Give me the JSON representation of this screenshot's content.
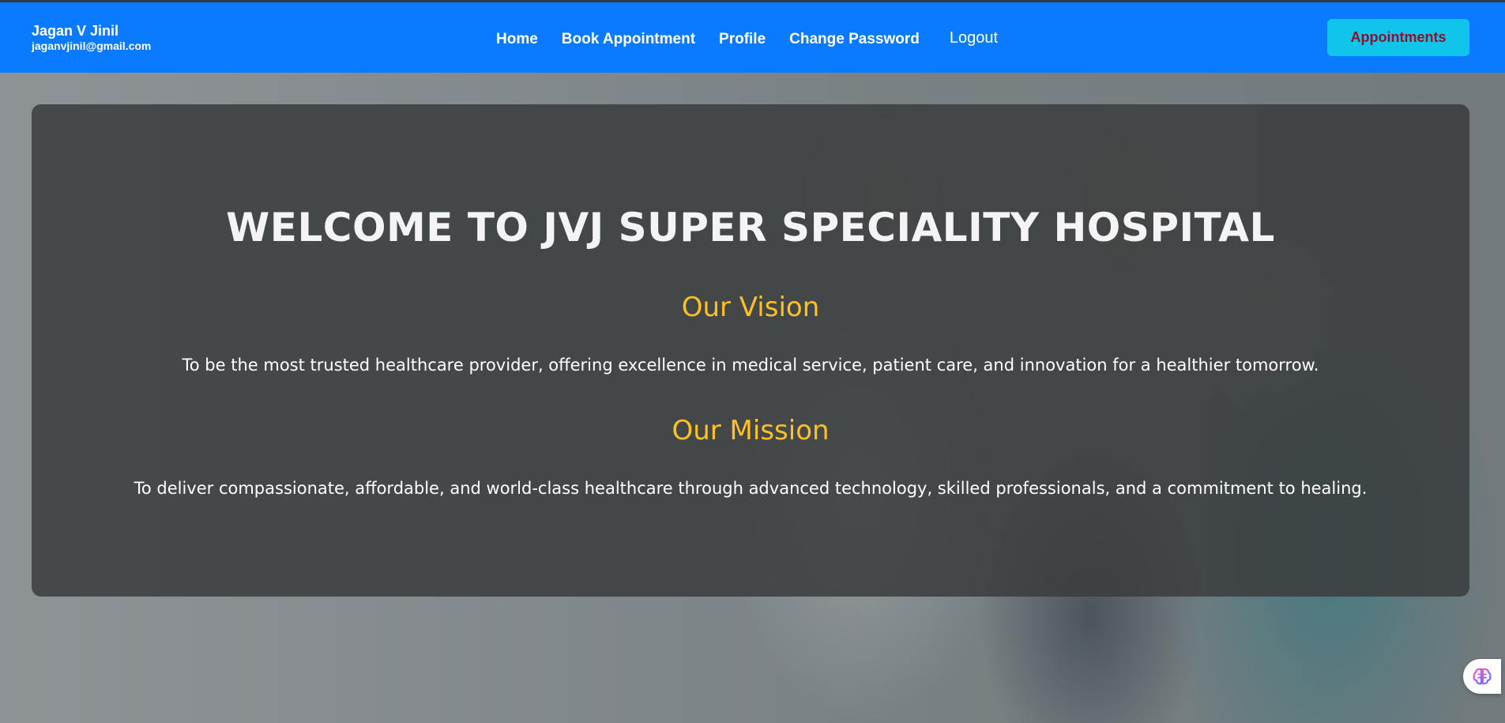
{
  "user": {
    "name": "Jagan V Jinil",
    "email": "jaganvjinil@gmail.com"
  },
  "nav": {
    "links": [
      {
        "label": "Home"
      },
      {
        "label": "Book Appointment"
      },
      {
        "label": "Profile"
      },
      {
        "label": "Change Password"
      },
      {
        "label": "Logout"
      }
    ],
    "appointments_button": "Appointments"
  },
  "hero": {
    "title": "WELCOME TO JVJ SUPER SPECIALITY HOSPITAL",
    "vision": {
      "heading": "Our Vision",
      "text": "To be the most trusted healthcare provider, offering excellence in medical service, patient care, and innovation for a healthier tomorrow."
    },
    "mission": {
      "heading": "Our Mission",
      "text": "To deliver compassionate, affordable, and world-class healthcare through advanced technology, skilled professionals, and a commitment to healing."
    }
  },
  "background": {
    "image_description_icon": "doctors-photo"
  },
  "assistant": {
    "icon": "brain-icon"
  },
  "colors": {
    "navbar": "#0a7bff",
    "appointments_button_bg": "#11c5ea",
    "appointments_button_text": "#8b1230",
    "section_heading": "#ffc021",
    "card_bg": "#3a3c3e"
  }
}
